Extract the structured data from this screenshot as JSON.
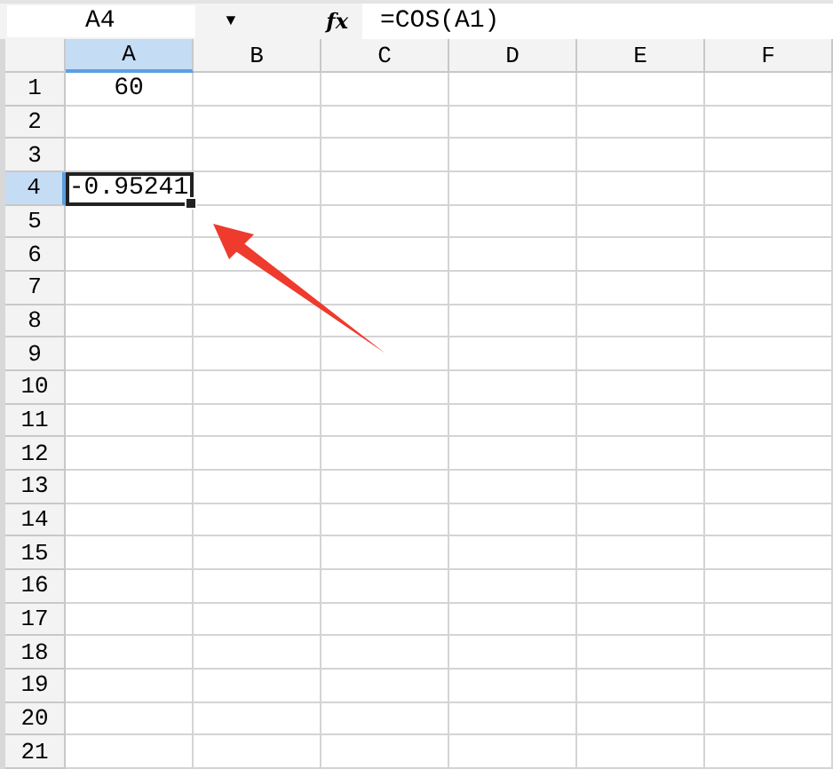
{
  "formula_bar": {
    "name_box": "A4",
    "dropdown": "▼",
    "fx": "fx",
    "formula": "=COS(A1)"
  },
  "columns": [
    {
      "label": "A",
      "selected": true
    },
    {
      "label": "B",
      "selected": false
    },
    {
      "label": "C",
      "selected": false
    },
    {
      "label": "D",
      "selected": false
    },
    {
      "label": "E",
      "selected": false
    },
    {
      "label": "F",
      "selected": false
    }
  ],
  "rows": [
    {
      "label": "1",
      "selected": false,
      "cells": [
        {
          "text": "60",
          "active": false
        }
      ]
    },
    {
      "label": "2",
      "selected": false
    },
    {
      "label": "3",
      "selected": false
    },
    {
      "label": "4",
      "selected": true,
      "cells": [
        {
          "text": "-0.95241",
          "active": true
        }
      ]
    },
    {
      "label": "5",
      "selected": false
    },
    {
      "label": "6",
      "selected": false
    },
    {
      "label": "7",
      "selected": false
    },
    {
      "label": "8",
      "selected": false
    },
    {
      "label": "9",
      "selected": false
    },
    {
      "label": "10",
      "selected": false
    },
    {
      "label": "11",
      "selected": false
    },
    {
      "label": "12",
      "selected": false
    },
    {
      "label": "13",
      "selected": false
    },
    {
      "label": "14",
      "selected": false
    },
    {
      "label": "15",
      "selected": false
    },
    {
      "label": "16",
      "selected": false
    },
    {
      "label": "17",
      "selected": false
    },
    {
      "label": "18",
      "selected": false
    },
    {
      "label": "19",
      "selected": false
    },
    {
      "label": "20",
      "selected": false
    },
    {
      "label": "21",
      "selected": false
    }
  ]
}
